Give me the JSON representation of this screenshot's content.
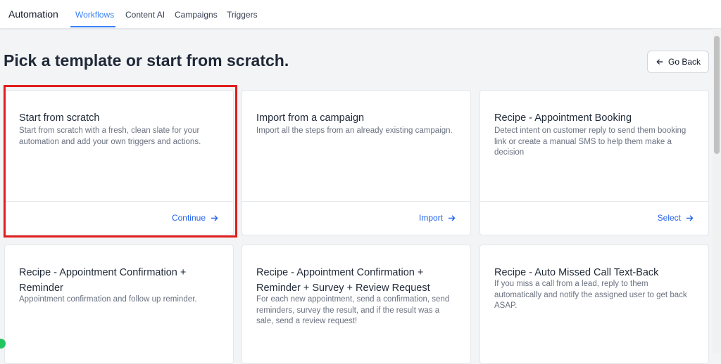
{
  "app": {
    "title": "Automation"
  },
  "tabs": [
    {
      "label": "Workflows",
      "active": true
    },
    {
      "label": "Content AI",
      "active": false
    },
    {
      "label": "Campaigns",
      "active": false
    },
    {
      "label": "Triggers",
      "active": false
    }
  ],
  "page": {
    "title": "Pick a template or start from scratch.",
    "go_back_label": "Go Back"
  },
  "cards": [
    {
      "title": "Start from scratch",
      "description": "Start from scratch with a fresh, clean slate for your automation and add your own triggers and actions.",
      "action": "Continue"
    },
    {
      "title": "Import from a campaign",
      "description": "Import all the steps from an already existing campaign.",
      "action": "Import"
    },
    {
      "title": "Recipe - Appointment Booking",
      "description": "Detect intent on customer reply to send them booking link or create a manual SMS to help them make a decision",
      "action": "Select"
    },
    {
      "title": "Recipe - Appointment Confirmation + Reminder",
      "description": "Appointment confirmation and follow up reminder."
    },
    {
      "title": "Recipe - Appointment Confirmation + Reminder + Survey + Review Request",
      "description": "For each new appointment, send a confirmation, send reminders, survey the result, and if the result was a sale, send a review request!"
    },
    {
      "title": "Recipe - Auto Missed Call Text-Back",
      "description": "If you miss a call from a lead, reply to them automatically and notify the assigned user to get back ASAP."
    }
  ],
  "colors": {
    "accent": "#3b82f6",
    "link": "#2563eb",
    "highlight": "#e11d1d"
  },
  "icons": {
    "go_back": "arrow-left-icon",
    "card_action": "arrow-right-icon"
  }
}
